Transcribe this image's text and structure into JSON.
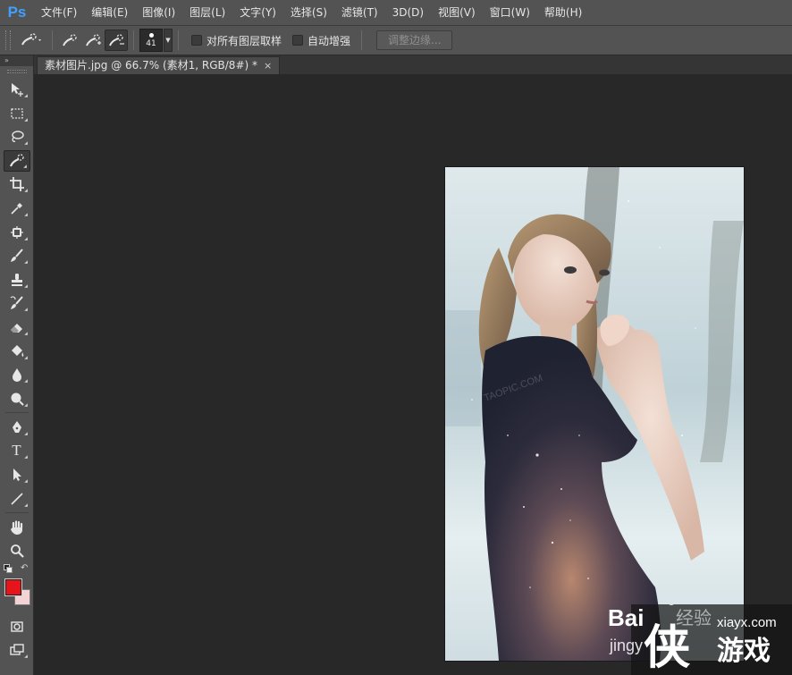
{
  "app": {
    "logo_text": "Ps",
    "accent_color": "#3fa0ff"
  },
  "menu": {
    "items": [
      "文件(F)",
      "编辑(E)",
      "图像(I)",
      "图层(L)",
      "文字(Y)",
      "选择(S)",
      "滤镜(T)",
      "3D(D)",
      "视图(V)",
      "窗口(W)",
      "帮助(H)"
    ]
  },
  "options": {
    "tool_icon": "quick-selection-icon",
    "modes": [
      {
        "name": "new-selection-icon",
        "active": false
      },
      {
        "name": "add-to-selection-icon",
        "active": false
      },
      {
        "name": "subtract-from-selection-icon",
        "active": true
      }
    ],
    "brush_size": "41",
    "sample_all_layers": {
      "label": "对所有图层取样",
      "checked": false
    },
    "auto_enhance": {
      "label": "自动增强",
      "checked": false
    },
    "refine_edge_label": "调整边缘..."
  },
  "document": {
    "tab_title": "素材图片.jpg @ 66.7% (素材1, RGB/8#) *",
    "close_glyph": "×"
  },
  "toolbar": {
    "collapse_glyph": "»",
    "tools": [
      {
        "name": "move-tool-icon",
        "active": false
      },
      {
        "name": "rectangular-marquee-tool-icon",
        "active": false
      },
      {
        "name": "lasso-tool-icon",
        "active": false
      },
      {
        "name": "quick-selection-tool-icon",
        "active": true
      },
      {
        "name": "crop-tool-icon",
        "active": false
      },
      {
        "name": "eyedropper-tool-icon",
        "active": false
      },
      {
        "name": "spot-healing-tool-icon",
        "active": false
      },
      {
        "name": "brush-tool-icon",
        "active": false
      },
      {
        "name": "clone-stamp-tool-icon",
        "active": false
      },
      {
        "name": "history-brush-tool-icon",
        "active": false
      },
      {
        "name": "eraser-tool-icon",
        "active": false
      },
      {
        "name": "paint-bucket-tool-icon",
        "active": false
      },
      {
        "name": "blur-tool-icon",
        "active": false
      },
      {
        "name": "dodge-tool-icon",
        "active": false
      },
      {
        "name": "pen-tool-icon",
        "active": false
      },
      {
        "name": "type-tool-icon",
        "active": false
      },
      {
        "name": "path-selection-tool-icon",
        "active": false
      },
      {
        "name": "line-tool-icon",
        "active": false
      },
      {
        "name": "hand-tool-icon",
        "active": false
      },
      {
        "name": "zoom-tool-icon",
        "active": false
      }
    ],
    "type_glyph": "T",
    "foreground_color": "#e8141c",
    "background_color": "#f3d3d3",
    "swap_glyph": "↶"
  },
  "watermark": {
    "baidu_text": "Bai",
    "baidu_sub": "jingy",
    "jingyan_text": "经验",
    "site_url": "xiayx.com",
    "brand_big": "侠",
    "brand_small": "游戏",
    "photo_mark": "TAOPIC.COM"
  }
}
